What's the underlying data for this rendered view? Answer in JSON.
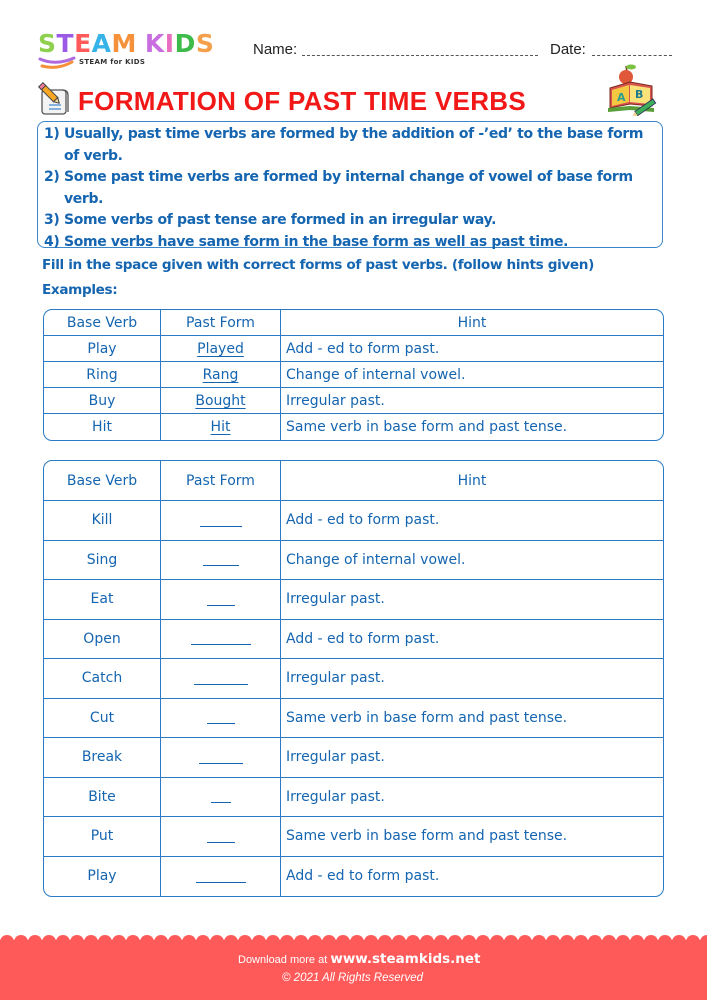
{
  "header": {
    "logo": {
      "text": "STEAM KIDS",
      "letters": [
        {
          "ch": "S",
          "color": "#8fd14f"
        },
        {
          "ch": "T",
          "color": "#9b59e6"
        },
        {
          "ch": "E",
          "color": "#ff5a5a"
        },
        {
          "ch": "A",
          "color": "#36b3e8"
        },
        {
          "ch": "M",
          "color": "#f5913b"
        },
        {
          "ch": " ",
          "color": "#ffffff"
        },
        {
          "ch": "K",
          "color": "#c96ee0"
        },
        {
          "ch": "I",
          "color": "#e86fbf"
        },
        {
          "ch": "D",
          "color": "#3dbb4a"
        },
        {
          "ch": "S",
          "color": "#f59f4a"
        }
      ],
      "subtitle": "STEAM for KIDS"
    },
    "name_label": "Name:",
    "date_label": "Date:",
    "title": "FORMATION OF PAST TIME VERBS"
  },
  "rules": [
    "1) Usually, past time verbs are formed by the addition of -’ed’ to the base form of verb.",
    "2) Some past time verbs are formed by internal change of vowel of base form verb.",
    "3) Some verbs of past tense are formed in an irregular way.",
    "4) Some verbs have same form in the base form as well as past time."
  ],
  "instruction": "Fill in the space given with correct forms of past verbs. (follow hints given)",
  "examples_label": "Examples:",
  "examples_table": {
    "headers": [
      "Base Verb",
      "Past Form",
      "Hint"
    ],
    "rows": [
      {
        "base": "Play",
        "past": "Played",
        "hint": "Add - ed to form past."
      },
      {
        "base": "Ring",
        "past": "Rang",
        "hint": "Change of internal vowel."
      },
      {
        "base": "Buy",
        "past": "Bought",
        "hint": "Irregular past."
      },
      {
        "base": "Hit",
        "past": "Hit",
        "hint": "Same verb in base form and past tense."
      }
    ]
  },
  "exercise_table": {
    "headers": [
      "Base Verb",
      "Past Form",
      "Hint"
    ],
    "rows": [
      {
        "base": "Kill",
        "blank": "_____",
        "hint": "Add - ed to form past."
      },
      {
        "base": "Sing",
        "blank": "____",
        "hint": "Change of internal vowel."
      },
      {
        "base": "Eat",
        "blank": "___",
        "hint": "Irregular past."
      },
      {
        "base": "Open",
        "blank": "_______",
        "hint": "Add - ed to form past."
      },
      {
        "base": "Catch",
        "blank": "______",
        "hint": "Irregular past."
      },
      {
        "base": "Cut",
        "blank": "___",
        "hint": "Same verb in base form and past tense."
      },
      {
        "base": "Break",
        "blank": "_____",
        "hint": "Irregular past."
      },
      {
        "base": "Bite",
        "blank": "__",
        "hint": "Irregular past."
      },
      {
        "base": "Put",
        "blank": "___",
        "hint": "Same verb in base form and past tense."
      },
      {
        "base": "Play",
        "blank": "______",
        "hint": "Add - ed to form past."
      }
    ]
  },
  "footer": {
    "download_prefix": "Download more at",
    "site": "www.steamkids.net",
    "copyright": "©  2021 All Rights Reserved",
    "color": "#ff5a5a"
  }
}
